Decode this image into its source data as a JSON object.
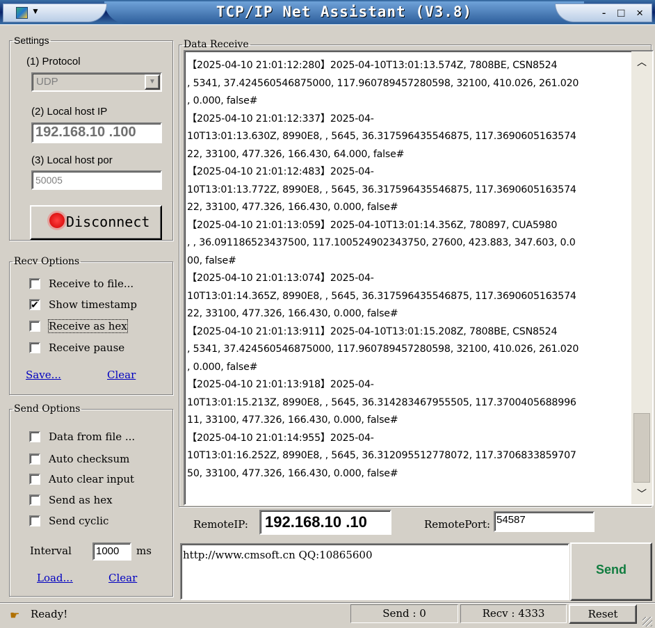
{
  "window": {
    "title": "TCP/IP Net Assistant (V3.8)",
    "controls": "- □ ×"
  },
  "settings": {
    "legend": "Settings",
    "protocol_label": "(1) Protocol",
    "protocol_value": "UDP",
    "local_ip_label": "(2) Local host IP",
    "local_ip_value": "192.168.10 .100",
    "local_port_label": "(3) Local host por",
    "local_port_value": "50005",
    "disconnect_label": "Disconnect"
  },
  "recv_options": {
    "legend": "Recv Options",
    "items": [
      {
        "label": "Receive to file...",
        "checked": false
      },
      {
        "label": "Show timestamp",
        "checked": true
      },
      {
        "label": "Receive as hex",
        "checked": false
      },
      {
        "label": "Receive pause",
        "checked": false
      }
    ],
    "save_link": "Save...",
    "clear_link": "Clear"
  },
  "send_options": {
    "legend": "Send Options",
    "items": [
      {
        "label": "Data from file ...",
        "checked": false
      },
      {
        "label": "Auto checksum",
        "checked": false
      },
      {
        "label": "Auto clear input",
        "checked": false
      },
      {
        "label": "Send as hex",
        "checked": false
      },
      {
        "label": "Send cyclic",
        "checked": false
      }
    ],
    "interval_label": "Interval",
    "interval_value": "1000",
    "interval_unit": "ms",
    "load_link": "Load...",
    "clear_link": "Clear"
  },
  "receive": {
    "legend": "Data Receive",
    "lines": [
      "【2025-04-10 21:01:12:280】2025-04-10T13:01:13.574Z, 7808BE, CSN8524",
      ", 5341, 37.424560546875000, 117.960789457280598, 32100, 410.026, 261.020",
      ", 0.000, false#",
      "【2025-04-10 21:01:12:337】2025-04-",
      "10T13:01:13.630Z, 8990E8, , 5645, 36.317596435546875, 117.3690605163574",
      "22, 33100, 477.326, 166.430, 64.000, false#",
      "【2025-04-10 21:01:12:483】2025-04-",
      "10T13:01:13.772Z, 8990E8, , 5645, 36.317596435546875, 117.3690605163574",
      "22, 33100, 477.326, 166.430, 0.000, false#",
      "【2025-04-10 21:01:13:059】2025-04-10T13:01:14.356Z, 780897, CUA5980",
      ", , 36.091186523437500, 117.100524902343750, 27600, 423.883, 347.603, 0.0",
      "00, false#",
      "【2025-04-10 21:01:13:074】2025-04-",
      "10T13:01:14.365Z, 8990E8, , 5645, 36.317596435546875, 117.3690605163574",
      "22, 33100, 477.326, 166.430, 0.000, false#",
      "【2025-04-10 21:01:13:911】2025-04-10T13:01:15.208Z, 7808BE, CSN8524",
      ", 5341, 37.424560546875000, 117.960789457280598, 32100, 410.026, 261.020",
      ", 0.000, false#",
      "【2025-04-10 21:01:13:918】2025-04-",
      "10T13:01:15.213Z, 8990E8, , 5645, 36.314283467955505, 117.3700405688996",
      "11, 33100, 477.326, 166.430, 0.000, false#",
      "【2025-04-10 21:01:14:955】2025-04-",
      "10T13:01:16.252Z, 8990E8, , 5645, 36.312095512778072, 117.3706833859707",
      "50, 33100, 477.326, 166.430, 0.000, false#"
    ]
  },
  "remote": {
    "ip_label": "RemoteIP:",
    "ip_value": "192.168.10 .10",
    "port_label": "RemotePort:",
    "port_value": "54587"
  },
  "send": {
    "input_value": "http://www.cmsoft.cn QQ:10865600",
    "send_button": "Send"
  },
  "status": {
    "ready": "Ready!",
    "send_count": "Send : 0",
    "recv_count": "Recv : 4333",
    "reset_button": "Reset"
  }
}
